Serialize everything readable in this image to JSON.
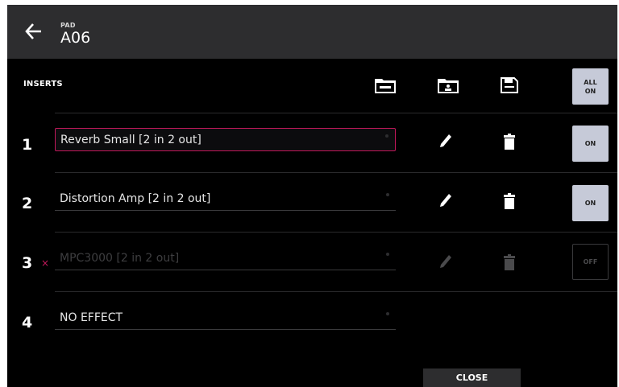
{
  "header": {
    "pad_label": "PAD",
    "pad_name": "A06"
  },
  "inserts": {
    "title": "INSERTS",
    "all_on_line1": "ALL",
    "all_on_line2": "ON",
    "slots": [
      {
        "number": "1",
        "effect": "Reverb Small [2 in 2 out]",
        "state": "ON",
        "selected": true,
        "enabled": true
      },
      {
        "number": "2",
        "effect": "Distortion Amp [2 in 2 out]",
        "state": "ON",
        "selected": false,
        "enabled": true
      },
      {
        "number": "3",
        "effect": "MPC3000 [2 in 2 out]",
        "state": "OFF",
        "selected": false,
        "enabled": false,
        "error_mark": "×"
      },
      {
        "number": "4",
        "effect": "NO EFFECT",
        "state": "",
        "selected": false,
        "enabled": true
      }
    ]
  },
  "footer": {
    "close_label": "CLOSE"
  },
  "colors": {
    "accent": "#c2185b",
    "toggle_on": "#c6cad8",
    "header_bg": "#2d2d2f"
  },
  "icons": {
    "back": "arrow-left-icon",
    "load_akai": "folder-akai-icon",
    "load_user": "folder-user-icon",
    "save": "floppy-disk-icon",
    "edit": "pencil-icon",
    "delete": "trash-icon"
  }
}
